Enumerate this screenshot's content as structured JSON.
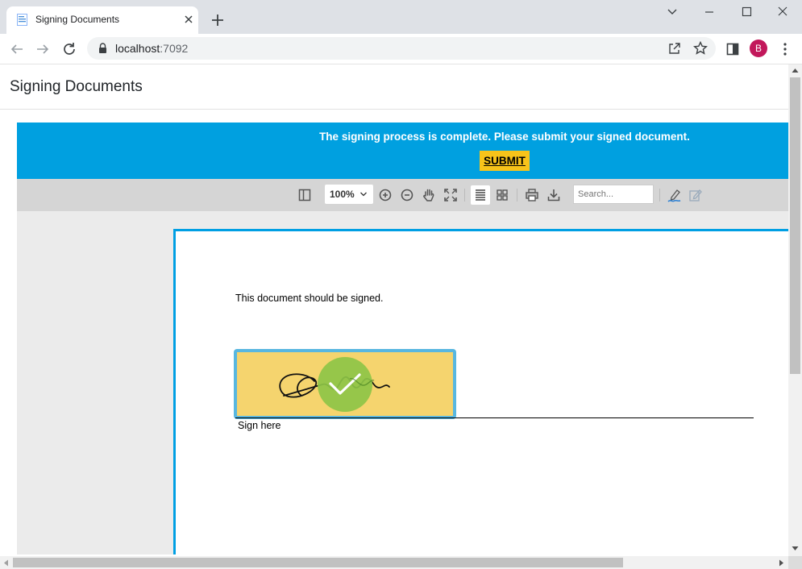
{
  "browser": {
    "tab_title": "Signing Documents",
    "url_host": "localhost",
    "url_port": ":7092",
    "avatar_letter": "B"
  },
  "page": {
    "title": "Signing Documents"
  },
  "banner": {
    "message": "The signing process is complete. Please submit your signed document.",
    "submit_label": "SUBMIT",
    "background": "#00a0e0",
    "button_color": "#f7c31a"
  },
  "viewer_toolbar": {
    "zoom": "100%",
    "search_placeholder": "Search...",
    "icons": [
      "sidebar-toggle-icon",
      "zoom-in-icon",
      "zoom-out-icon",
      "pan-hand-icon",
      "fit-page-icon",
      "single-page-view-icon",
      "thumbnail-grid-icon",
      "print-icon",
      "download-icon",
      "sign-pen-icon",
      "edit-form-icon"
    ]
  },
  "document": {
    "text": "This document should be signed.",
    "sign_label": "Sign here",
    "signature_field_color": "#f5d46e",
    "signed_check_color": "#8dc447"
  }
}
